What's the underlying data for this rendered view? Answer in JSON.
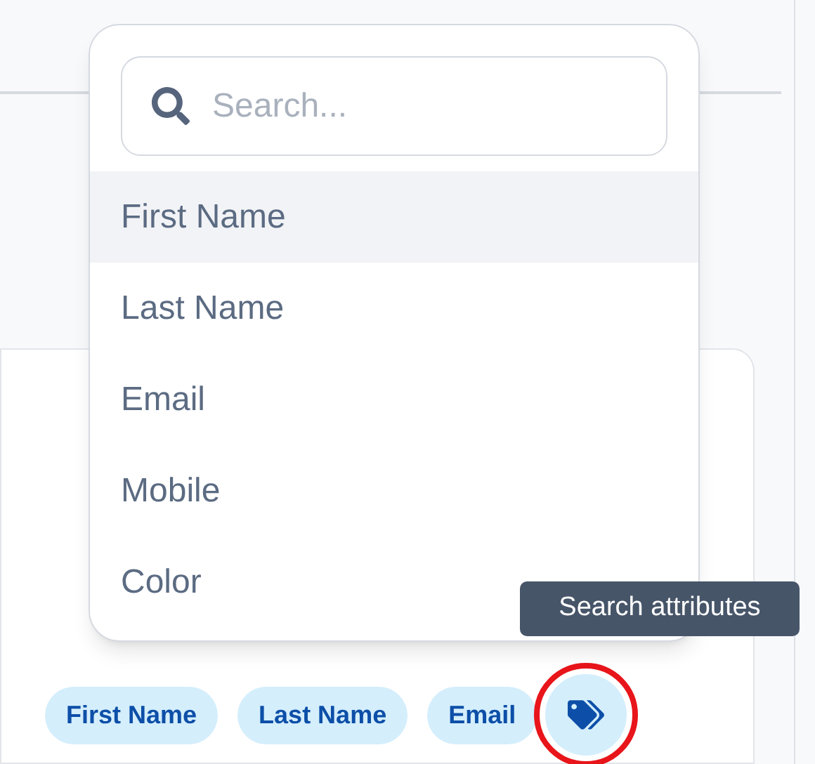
{
  "popup": {
    "search": {
      "placeholder": "Search..."
    },
    "items": [
      {
        "label": "First Name",
        "selected": true
      },
      {
        "label": "Last Name",
        "selected": false
      },
      {
        "label": "Email",
        "selected": false
      },
      {
        "label": "Mobile",
        "selected": false
      },
      {
        "label": "Color",
        "selected": false
      }
    ]
  },
  "tooltip": "Search attributes",
  "chips": [
    "First Name",
    "Last Name",
    "Email"
  ],
  "tag_button": {
    "highlighted": true
  }
}
